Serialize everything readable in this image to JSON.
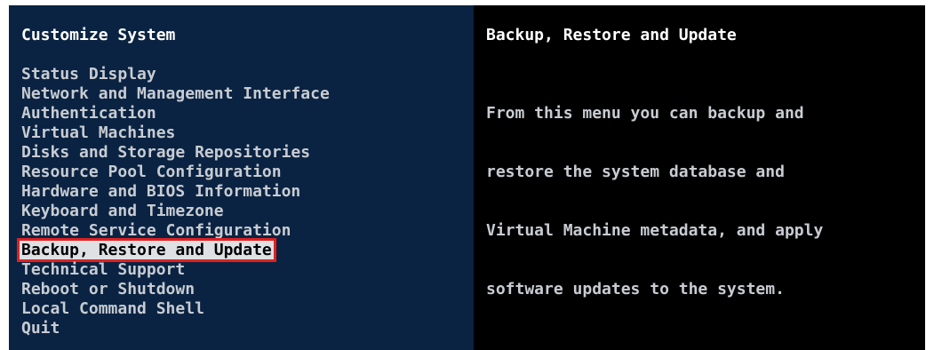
{
  "left_pane": {
    "title": "Customize System",
    "menu_items": [
      {
        "label": "Status Display"
      },
      {
        "label": "Network and Management Interface"
      },
      {
        "label": "Authentication"
      },
      {
        "label": "Virtual Machines"
      },
      {
        "label": "Disks and Storage Repositories"
      },
      {
        "label": "Resource Pool Configuration"
      },
      {
        "label": "Hardware and BIOS Information"
      },
      {
        "label": "Keyboard and Timezone"
      },
      {
        "label": "Remote Service Configuration"
      },
      {
        "label": "Backup, Restore and Update"
      },
      {
        "label": "Technical Support"
      },
      {
        "label": "Reboot or Shutdown"
      },
      {
        "label": "Local Command Shell"
      },
      {
        "label": "Quit"
      }
    ],
    "selected_index": 9
  },
  "right_pane": {
    "title": "Backup, Restore and Update",
    "description_lines": [
      "From this menu you can backup and",
      "restore the system database and",
      "Virtual Machine metadata, and apply",
      "software updates to the system."
    ]
  },
  "colors": {
    "left_background": "#0a2342",
    "right_background": "#000000",
    "highlight_background": "#dfe0e4",
    "highlight_border": "#e02020"
  }
}
